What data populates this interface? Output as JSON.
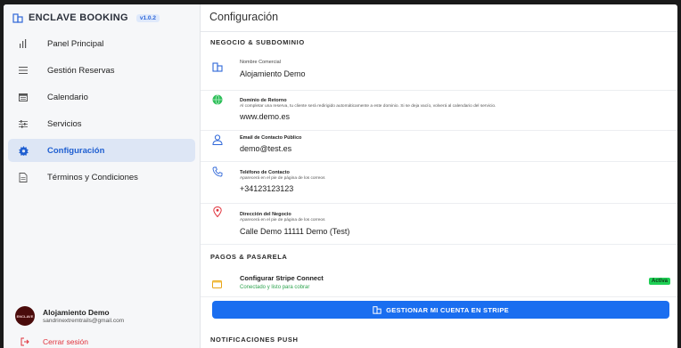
{
  "app": {
    "name": "ENCLAVE BOOKING",
    "version": "v1.0.2"
  },
  "sidebar": {
    "items": [
      {
        "label": "Panel Principal",
        "icon": "bar-chart-icon"
      },
      {
        "label": "Gestión Reservas",
        "icon": "list-icon"
      },
      {
        "label": "Calendario",
        "icon": "calendar-icon"
      },
      {
        "label": "Servicios",
        "icon": "sliders-icon"
      },
      {
        "label": "Configuración",
        "icon": "gear-icon",
        "active": true
      },
      {
        "label": "Términos y Condiciones",
        "icon": "document-icon"
      }
    ],
    "user": {
      "name": "Alojamiento Demo",
      "email": "sandrinextremtrails@gmail.com",
      "avatar_text": "ENCLAVE"
    },
    "logout_label": "Cerrar sesión"
  },
  "main": {
    "title": "Configuración",
    "business_section": "NEGOCIO & SUBDOMINIO",
    "fields": {
      "commercial_name": {
        "label": "Nombre Comercial",
        "value": "Alojamiento Demo"
      },
      "return_domain": {
        "label": "Dominio de Retorno",
        "help": "Al completar una reserva, tu cliente será redirigido automáticamente a este dominio. Si se deja vacío, volverá al calendario del servicio.",
        "value": "www.demo.es"
      },
      "public_email": {
        "label": "Email de Contacto Público",
        "value": "demo@test.es"
      },
      "phone": {
        "label": "Teléfono de Contacto",
        "help": "Aparecerá en el pie de página de los correos",
        "value": "+34123123123"
      },
      "address": {
        "label": "Dirección del Negocio",
        "help": "Aparecerá en el pie de página de los correos",
        "value": "Calle Demo 11111 Demo (Test)"
      }
    },
    "payments_section": "PAGOS & PASARELA",
    "stripe": {
      "title": "Configurar Stripe Connect",
      "status_text": "Conectado y listo para cobrar",
      "badge": "Activa",
      "button_label": "GESTIONAR MI CUENTA EN STRIPE"
    },
    "notifications_section": "NOTIFICACIONES PUSH"
  },
  "colors": {
    "accent": "#1a6ef0",
    "active_bg": "#dde6f5",
    "success": "#1fcf55",
    "danger": "#e0323c"
  }
}
